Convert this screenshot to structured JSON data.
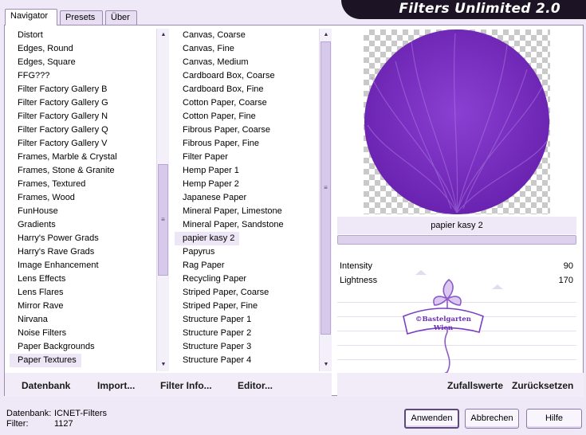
{
  "window": {
    "title": "Filters Unlimited 2.0"
  },
  "tabs": [
    {
      "label": "Navigator",
      "active": true
    },
    {
      "label": "Presets",
      "active": false
    },
    {
      "label": "Über",
      "active": false
    }
  ],
  "categories": {
    "items": [
      "Distort",
      "Edges, Round",
      "Edges, Square",
      "FFG???",
      "Filter Factory Gallery B",
      "Filter Factory Gallery G",
      "Filter Factory Gallery N",
      "Filter Factory Gallery Q",
      "Filter Factory Gallery V",
      "Frames, Marble & Crystal",
      "Frames, Stone & Granite",
      "Frames, Textured",
      "Frames, Wood",
      "FunHouse",
      "Gradients",
      "Harry's Power Grads",
      "Harry's Rave Grads",
      "Image Enhancement",
      "Lens Effects",
      "Lens Flares",
      "Mirror Rave",
      "Nirvana",
      "Noise Filters",
      "Paper Backgrounds",
      "Paper Textures"
    ],
    "selected_index": 24
  },
  "filters": {
    "items": [
      "Canvas, Coarse",
      "Canvas, Fine",
      "Canvas, Medium",
      "Cardboard Box, Coarse",
      "Cardboard Box, Fine",
      "Cotton Paper, Coarse",
      "Cotton Paper, Fine",
      "Fibrous Paper, Coarse",
      "Fibrous Paper, Fine",
      "Filter Paper",
      "Hemp Paper 1",
      "Hemp Paper 2",
      "Japanese Paper",
      "Mineral Paper, Limestone",
      "Mineral Paper, Sandstone",
      "papier kasy 2",
      "Papyrus",
      "Rag Paper",
      "Recycling Paper",
      "Striped Paper, Coarse",
      "Striped Paper, Fine",
      "Structure Paper 1",
      "Structure Paper 2",
      "Structure Paper 3",
      "Structure Paper 4"
    ],
    "selected_index": 15
  },
  "bottom_links": {
    "database": "Datenbank",
    "import": "Import...",
    "filter_info": "Filter Info...",
    "editor": "Editor...",
    "random": "Zufallswerte",
    "reset": "Zurücksetzen"
  },
  "preview": {
    "name": "papier kasy 2",
    "circle_color": "#7a2fc2",
    "watermark_text_1": "©Bastelgarten",
    "watermark_text_2": "Wien"
  },
  "params": [
    {
      "label": "Intensity",
      "value": "90",
      "level": 0.35
    },
    {
      "label": "Lightness",
      "value": "170",
      "level": 0.67
    }
  ],
  "status": {
    "db_label": "Datenbank:",
    "db_value": "ICNET-Filters",
    "filter_label": "Filter:",
    "filter_value": "1127"
  },
  "buttons": {
    "apply": "Anwenden",
    "cancel": "Abbrechen",
    "help": "Hilfe"
  },
  "colors": {
    "accent": "#7a2fc2",
    "background": "#efe8f7",
    "banner": "#1c1324"
  }
}
